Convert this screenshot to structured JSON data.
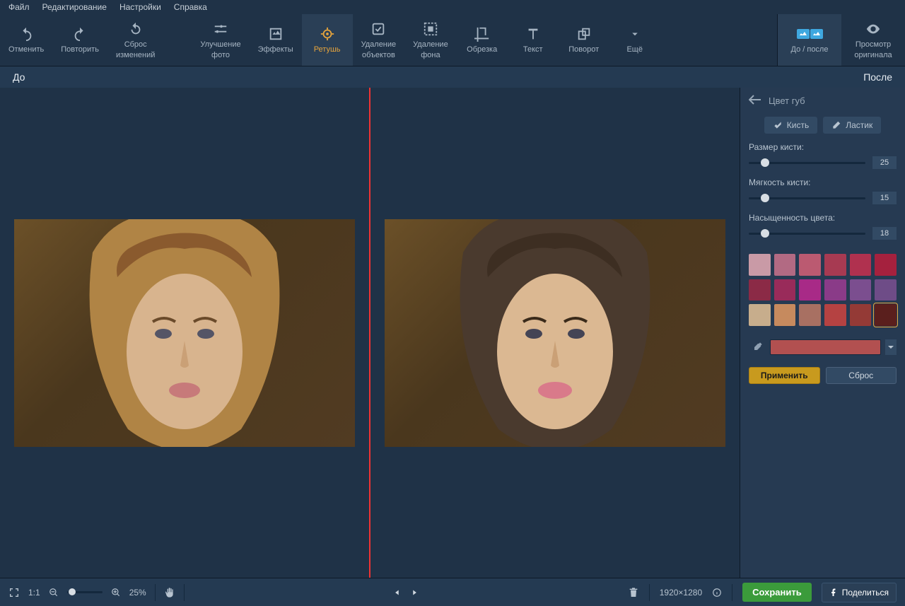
{
  "menu": {
    "file": "Файл",
    "edit": "Редактирование",
    "settings": "Настройки",
    "help": "Справка"
  },
  "toolbar": {
    "undo": "Отменить",
    "redo": "Повторить",
    "reset": "Сброс\nизменений",
    "enhance": "Улучшение\nфото",
    "effects": "Эффекты",
    "retouch": "Ретушь",
    "remove_obj": "Удаление\nобъектов",
    "remove_bg": "Удаление\nфона",
    "crop": "Обрезка",
    "text": "Текст",
    "rotate": "Поворот",
    "more": "Ещё",
    "before_after": "До / после",
    "view_original": "Просмотр\nоригинала"
  },
  "workbar": {
    "before": "До",
    "after": "После"
  },
  "sidebar": {
    "title": "Цвет губ",
    "brush": "Кисть",
    "eraser": "Ластик",
    "brush_size_label": "Размер кисти:",
    "brush_size_val": "25",
    "softness_label": "Мягкость кисти:",
    "softness_val": "15",
    "saturation_label": "Насыщенность цвета:",
    "saturation_val": "18",
    "swatches": [
      "#c99aa6",
      "#b26a83",
      "#bb5a71",
      "#a73a52",
      "#b0314f",
      "#a5213e",
      "#8b2a46",
      "#992b5a",
      "#a82a87",
      "#8a3b88",
      "#7b4e8f",
      "#6e4c87",
      "#c7ad8c",
      "#c68a5e",
      "#a87062",
      "#b54242",
      "#943a36",
      "#5a1f1d"
    ],
    "current_color": "#b25050",
    "apply": "Применить",
    "reset": "Сброс"
  },
  "bottombar": {
    "scale_11": "1:1",
    "zoom": "25%",
    "dims": "1920×1280",
    "save": "Сохранить",
    "share": "Поделиться"
  },
  "slider_pos": {
    "brush_size": 14,
    "softness": 14,
    "saturation": 14
  }
}
